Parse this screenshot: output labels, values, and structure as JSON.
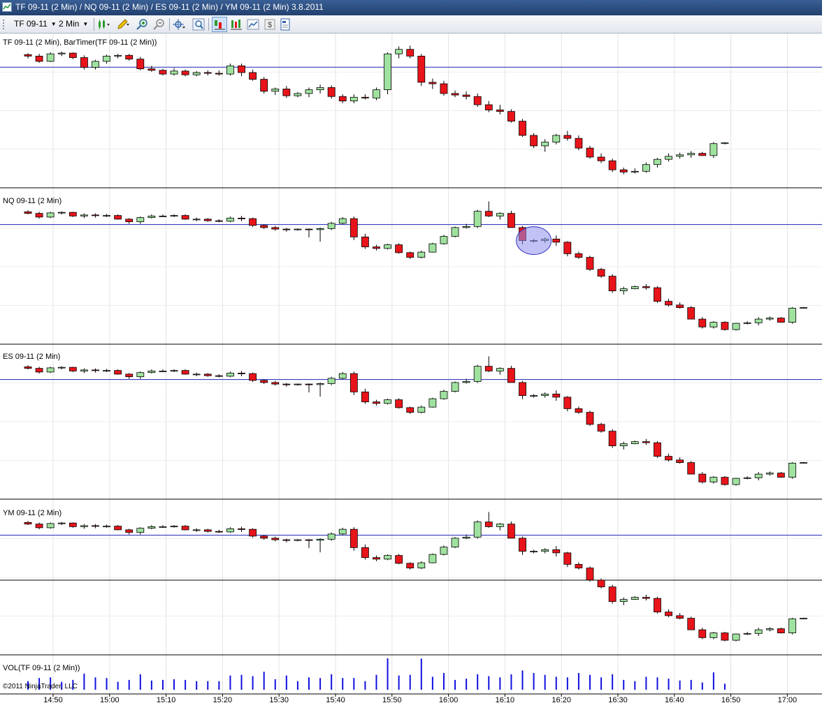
{
  "window": {
    "title": "TF 09-11 (2 Min) / NQ 09-11 (2 Min) / ES 09-11 (2 Min) / YM 09-11 (2 Min)  3.8.2011"
  },
  "toolbar": {
    "instrument": "TF 09-11",
    "interval": "2 Min"
  },
  "panels": [
    {
      "label": "TF 09-11 (2 Min), BarTimer(TF 09-11 (2 Min))"
    },
    {
      "label": "NQ 09-11 (2 Min)"
    },
    {
      "label": "ES 09-11 (2 Min)"
    },
    {
      "label": "YM 09-11 (2 Min)"
    },
    {
      "label": "VOL(TF 09-11 (2 Min))"
    }
  ],
  "copyright": "©2011 NinjaTrader, LLC",
  "colors": {
    "up": "#9fe29f",
    "down": "#e8141a",
    "ref_line": "#1f23b4",
    "volume": "#1010e0",
    "highlight": "#8f8ff0"
  },
  "chart_data": {
    "type": "candlestick",
    "x_tick_labels": [
      "14:50",
      "15:00",
      "15:10",
      "15:20",
      "15:30",
      "15:40",
      "15:50",
      "16:00",
      "16:10",
      "16:20",
      "16:30",
      "16:40",
      "16:50",
      "17:00"
    ],
    "series": [
      {
        "ticks": [
          [
            14.5,
            "14:44"
          ],
          [
            0,
            "17:07"
          ]
        ],
        "ohlc": [
          [
            10.02,
            10.04,
            9.97,
            10.0
          ],
          [
            10.0,
            10.03,
            9.91,
            9.93
          ],
          [
            9.93,
            10.05,
            9.92,
            10.03
          ],
          [
            10.03,
            10.06,
            10.0,
            10.04
          ],
          [
            10.04,
            10.05,
            9.96,
            9.98
          ],
          [
            9.98,
            10.01,
            9.82,
            9.85
          ],
          [
            9.85,
            9.95,
            9.82,
            9.93
          ],
          [
            9.93,
            10.02,
            9.9,
            10.0
          ],
          [
            10.0,
            10.03,
            9.97,
            10.01
          ],
          [
            10.01,
            10.03,
            9.94,
            9.96
          ],
          [
            9.96,
            9.99,
            9.81,
            9.83
          ],
          [
            9.83,
            9.87,
            9.79,
            9.81
          ],
          [
            9.81,
            9.83,
            9.74,
            9.76
          ],
          [
            9.76,
            9.84,
            9.74,
            9.8
          ],
          [
            9.8,
            9.82,
            9.73,
            9.75
          ],
          [
            9.75,
            9.8,
            9.73,
            9.78
          ],
          [
            9.78,
            9.81,
            9.74,
            9.77
          ],
          [
            9.77,
            9.81,
            9.74,
            9.76
          ],
          [
            9.76,
            9.9,
            9.74,
            9.87
          ],
          [
            9.87,
            9.9,
            9.73,
            9.78
          ],
          [
            9.78,
            9.82,
            9.67,
            9.69
          ],
          [
            9.69,
            9.72,
            9.5,
            9.53
          ],
          [
            9.53,
            9.58,
            9.48,
            9.56
          ],
          [
            9.56,
            9.6,
            9.44,
            9.47
          ],
          [
            9.47,
            9.52,
            9.45,
            9.5
          ],
          [
            9.5,
            9.58,
            9.45,
            9.55
          ],
          [
            9.55,
            9.62,
            9.5,
            9.58
          ],
          [
            9.58,
            9.61,
            9.43,
            9.46
          ],
          [
            9.46,
            9.49,
            9.37,
            9.4
          ],
          [
            9.4,
            9.49,
            9.37,
            9.45
          ],
          [
            9.45,
            9.49,
            9.42,
            9.44
          ],
          [
            9.44,
            9.58,
            9.41,
            9.55
          ],
          [
            9.55,
            10.05,
            9.49,
            10.03
          ],
          [
            10.03,
            10.13,
            9.97,
            10.09
          ],
          [
            10.09,
            10.14,
            9.97,
            10.0
          ],
          [
            10.0,
            10.03,
            9.6,
            9.65
          ],
          [
            9.65,
            9.7,
            9.56,
            9.63
          ],
          [
            9.63,
            9.67,
            9.47,
            9.5
          ],
          [
            9.5,
            9.54,
            9.45,
            9.48
          ],
          [
            9.48,
            9.53,
            9.42,
            9.46
          ],
          [
            9.46,
            9.5,
            9.32,
            9.35
          ],
          [
            9.35,
            9.4,
            9.25,
            9.28
          ],
          [
            9.28,
            9.35,
            9.22,
            9.26
          ],
          [
            9.26,
            9.29,
            9.11,
            9.13
          ],
          [
            9.13,
            9.16,
            8.92,
            8.94
          ],
          [
            8.94,
            8.97,
            8.77,
            8.8
          ],
          [
            8.8,
            8.89,
            8.72,
            8.85
          ],
          [
            8.85,
            8.96,
            8.82,
            8.94
          ],
          [
            8.94,
            9.0,
            8.87,
            8.9
          ],
          [
            8.9,
            8.94,
            8.74,
            8.77
          ],
          [
            8.77,
            8.8,
            8.63,
            8.65
          ],
          [
            8.65,
            8.7,
            8.57,
            8.6
          ],
          [
            8.6,
            8.63,
            8.45,
            8.48
          ],
          [
            8.48,
            8.51,
            8.42,
            8.45
          ],
          [
            8.45,
            8.5,
            8.43,
            8.46
          ],
          [
            8.46,
            8.58,
            8.44,
            8.55
          ],
          [
            8.55,
            8.64,
            8.51,
            8.62
          ],
          [
            8.62,
            8.7,
            8.59,
            8.66
          ],
          [
            8.66,
            8.71,
            8.63,
            8.68
          ],
          [
            8.68,
            8.73,
            8.64,
            8.7
          ],
          [
            8.7,
            8.72,
            8.67,
            8.67
          ],
          [
            8.67,
            8.85,
            8.64,
            8.83
          ],
          [
            8.83,
            8.85,
            8.82,
            8.84
          ]
        ]
      },
      {
        "ticks": [
          [
            36,
            "16:48"
          ],
          [
            0,
            "17:07"
          ]
        ],
        "ohlc": [
          [
            20.05,
            20.08,
            20.0,
            20.02
          ],
          [
            20.02,
            20.05,
            19.92,
            19.95
          ],
          [
            19.95,
            20.05,
            19.93,
            20.03
          ],
          [
            20.03,
            20.06,
            20.0,
            20.04
          ],
          [
            20.04,
            20.05,
            19.95,
            19.97
          ],
          [
            19.97,
            20.02,
            19.93,
            19.99
          ],
          [
            19.99,
            20.02,
            19.94,
            19.98
          ],
          [
            19.98,
            20.01,
            19.95,
            19.98
          ],
          [
            19.98,
            20.0,
            19.9,
            19.91
          ],
          [
            19.91,
            19.93,
            19.82,
            19.86
          ],
          [
            19.86,
            19.96,
            19.82,
            19.94
          ],
          [
            19.94,
            20.0,
            19.92,
            19.97
          ],
          [
            19.97,
            20.0,
            19.95,
            19.97
          ],
          [
            19.97,
            20.0,
            19.95,
            19.98
          ],
          [
            19.98,
            20.0,
            19.9,
            19.91
          ],
          [
            19.91,
            19.94,
            19.87,
            19.91
          ],
          [
            19.91,
            19.93,
            19.86,
            19.88
          ],
          [
            19.88,
            19.91,
            19.85,
            19.87
          ],
          [
            19.87,
            19.96,
            19.85,
            19.93
          ],
          [
            19.93,
            19.97,
            19.87,
            19.92
          ],
          [
            19.92,
            19.94,
            19.76,
            19.79
          ],
          [
            19.79,
            19.81,
            19.72,
            19.75
          ],
          [
            19.75,
            19.78,
            19.69,
            19.72
          ],
          [
            19.72,
            19.74,
            19.67,
            19.71
          ],
          [
            19.71,
            19.73,
            19.69,
            19.72
          ],
          [
            19.72,
            19.73,
            19.56,
            19.71
          ],
          [
            19.71,
            19.75,
            19.48,
            19.73
          ],
          [
            19.73,
            19.86,
            19.7,
            19.83
          ],
          [
            19.83,
            19.95,
            19.81,
            19.92
          ],
          [
            19.92,
            19.96,
            19.51,
            19.57
          ],
          [
            19.57,
            19.63,
            19.34,
            19.38
          ],
          [
            19.38,
            19.42,
            19.31,
            19.35
          ],
          [
            19.35,
            19.44,
            19.33,
            19.42
          ],
          [
            19.42,
            19.45,
            19.25,
            19.27
          ],
          [
            19.27,
            19.29,
            19.15,
            19.18
          ],
          [
            19.18,
            19.31,
            19.16,
            19.28
          ],
          [
            19.28,
            19.46,
            19.27,
            19.44
          ],
          [
            19.44,
            19.61,
            19.42,
            19.58
          ],
          [
            19.58,
            19.77,
            19.56,
            19.75
          ],
          [
            19.75,
            19.82,
            19.73,
            19.77
          ],
          [
            19.77,
            20.09,
            19.74,
            20.06
          ],
          [
            20.06,
            20.25,
            19.95,
            19.97
          ],
          [
            19.97,
            20.04,
            19.9,
            20.02
          ],
          [
            20.02,
            20.07,
            19.75,
            19.75
          ],
          [
            19.75,
            19.78,
            19.43,
            19.5
          ],
          [
            19.5,
            19.53,
            19.46,
            19.5
          ],
          [
            19.5,
            19.56,
            19.46,
            19.53
          ],
          [
            19.53,
            19.6,
            19.4,
            19.47
          ],
          [
            19.47,
            19.49,
            19.2,
            19.25
          ],
          [
            19.25,
            19.29,
            19.15,
            19.18
          ],
          [
            19.18,
            19.21,
            18.92,
            18.95
          ],
          [
            18.95,
            18.98,
            18.79,
            18.82
          ],
          [
            18.82,
            18.86,
            18.5,
            18.54
          ],
          [
            18.54,
            18.62,
            18.47,
            18.58
          ],
          [
            18.58,
            18.64,
            18.57,
            18.62
          ],
          [
            18.62,
            18.67,
            18.56,
            18.6
          ],
          [
            18.6,
            18.63,
            18.31,
            18.34
          ],
          [
            18.34,
            18.39,
            18.24,
            18.27
          ],
          [
            18.27,
            18.32,
            18.2,
            18.22
          ],
          [
            18.22,
            18.25,
            18.0,
            18.0
          ],
          [
            18.0,
            18.04,
            17.82,
            17.85
          ],
          [
            17.85,
            17.96,
            17.82,
            17.94
          ],
          [
            17.94,
            17.96,
            17.78,
            17.8
          ],
          [
            17.8,
            17.93,
            17.78,
            17.92
          ],
          [
            17.92,
            17.96,
            17.9,
            17.93
          ],
          [
            17.93,
            18.04,
            17.88,
            18.0
          ],
          [
            18.0,
            18.05,
            17.97,
            18.02
          ],
          [
            18.02,
            18.04,
            17.93,
            17.94
          ],
          [
            17.94,
            18.23,
            17.91,
            18.21
          ],
          [
            18.21,
            18.23,
            18.2,
            18.22
          ]
        ]
      }
    ]
  }
}
